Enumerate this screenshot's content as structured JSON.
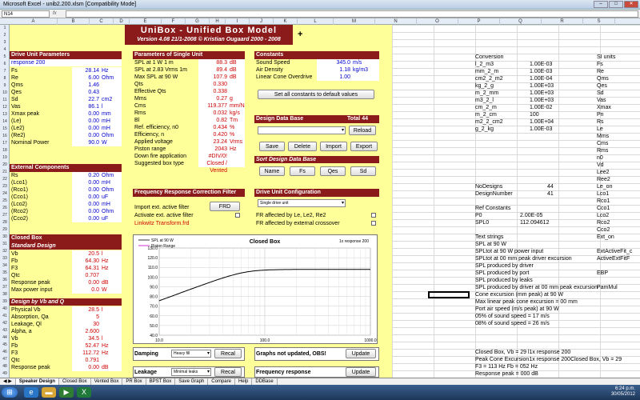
{
  "window": {
    "title": "Microsoft Excel - unib2.200.xlsm [Compatibility Mode]",
    "namebox": "N14",
    "fx": "fx"
  },
  "columns": [
    "A",
    "B",
    "C",
    "D",
    "E",
    "F",
    "G",
    "H",
    "I",
    "J",
    "K",
    "L",
    "M",
    "N",
    "O",
    "P",
    "Q",
    "R",
    "S"
  ],
  "rows": [
    "1",
    "2",
    "3",
    "4",
    "5",
    "6",
    "7",
    "8",
    "9",
    "10",
    "11",
    "12",
    "13",
    "14",
    "15",
    "16",
    "17",
    "18",
    "19",
    "20",
    "21",
    "22",
    "23",
    "24",
    "25",
    "26",
    "27",
    "28",
    "29",
    "30",
    "31",
    "32",
    "33",
    "34",
    "35",
    "36",
    "37",
    "38",
    "39",
    "40",
    "41",
    "42",
    "43",
    "44",
    "45",
    "46",
    "47",
    "48",
    "49",
    "50"
  ],
  "banner": {
    "title": "UniBox  -  Unified Box Model",
    "subtitle": "Version 4.08  21/1-2008   ©  Kristian Ougaard  2000 - 2008"
  },
  "drive": {
    "header": "Drive Unit Parameters",
    "name": "response 200",
    "rows": [
      {
        "l": "Fs",
        "v": "28.14",
        "u": "Hz"
      },
      {
        "l": "Re",
        "v": "6.00",
        "u": "Ohm"
      },
      {
        "l": "Qms",
        "v": "1.46",
        "u": ""
      },
      {
        "l": "Qes",
        "v": "0.43",
        "u": ""
      },
      {
        "l": "Sd",
        "v": "22.7",
        "u": "cm2"
      },
      {
        "l": "Vas",
        "v": "86.1",
        "u": "l"
      },
      {
        "l": "Xmax peak",
        "v": "0.00",
        "u": "mm"
      },
      {
        "l": "(Le)",
        "v": "0.00",
        "u": "mH"
      },
      {
        "l": "(Le2)",
        "v": "0.00",
        "u": "mH"
      },
      {
        "l": "(Re2)",
        "v": "0.00",
        "u": "Ohm"
      },
      {
        "l": "Nominal Power",
        "v": "90.0",
        "u": "W"
      }
    ]
  },
  "external": {
    "header": "External Components",
    "rows": [
      {
        "l": "Rs",
        "v": "0.20",
        "u": "Ohm"
      },
      {
        "l": "(Lco1)",
        "v": "0.00",
        "u": "mH"
      },
      {
        "l": "(Rco1)",
        "v": "0.00",
        "u": "Ohm"
      },
      {
        "l": "(Cco1)",
        "v": "0.00",
        "u": "uF"
      },
      {
        "l": "(Lco2)",
        "v": "0.00",
        "u": "mH"
      },
      {
        "l": "(Rco2)",
        "v": "0.00",
        "u": "Ohm"
      },
      {
        "l": "(Cco2)",
        "v": "0.00",
        "u": "uF"
      }
    ]
  },
  "closedbox": {
    "header": "Closed Box",
    "sub1": "Standard Design",
    "rows1": [
      {
        "l": "Vb",
        "v": "20.5",
        "u": "l"
      },
      {
        "l": "Fb",
        "v": "64.30",
        "u": "Hz"
      },
      {
        "l": "F3",
        "v": "64.31",
        "u": "Hz"
      },
      {
        "l": "Qtc",
        "v": "0.707",
        "u": ""
      },
      {
        "l": "Response peak",
        "v": "0.00",
        "u": "dB"
      },
      {
        "l": "Max power input",
        "v": "0.0",
        "u": "W"
      }
    ],
    "sub2": "Design by Vb and Q",
    "rows2": [
      {
        "l": "Physical Vb",
        "v": "28.5",
        "u": "l"
      },
      {
        "l": "Absorption, Qa",
        "v": "5",
        "u": ""
      },
      {
        "l": "Leakage, Ql",
        "v": "30",
        "u": ""
      },
      {
        "l": "Alpha, a",
        "v": "2.600",
        "u": ""
      },
      {
        "l": "Vb",
        "v": "34.5",
        "u": "l"
      },
      {
        "l": "Fb",
        "v": "52.47",
        "u": "Hz"
      },
      {
        "l": "F3",
        "v": "112.72",
        "u": "Hz"
      },
      {
        "l": "Qtc",
        "v": "0.791",
        "u": ""
      },
      {
        "l": "Response peak",
        "v": "0.00",
        "u": "dB"
      }
    ]
  },
  "single": {
    "header": "Parameters of Single Unit",
    "rows": [
      {
        "l": "SPL at 1 W 1 m",
        "v": "88.3",
        "u": "dB"
      },
      {
        "l": "SPL at 2.83 Vrms 1m",
        "v": "89.4",
        "u": "dB"
      },
      {
        "l": "Max SPL at 90 W",
        "v": "107.9",
        "u": "dB"
      },
      {
        "l": "Qts",
        "v": "0.330",
        "u": ""
      },
      {
        "l": "Effective Qts",
        "v": "0.338",
        "u": ""
      },
      {
        "l": "Mms",
        "v": "0.27",
        "u": "g"
      },
      {
        "l": "Cms",
        "v": "119.377",
        "u": "mm/N"
      },
      {
        "l": "Rms",
        "v": "0.032",
        "u": "kg/s"
      },
      {
        "l": "Bl",
        "v": "0.82",
        "u": "Tm"
      },
      {
        "l": "Ref. efficiency, n0",
        "v": "0.434",
        "u": "%"
      },
      {
        "l": "Efficiency, n",
        "v": "0.420",
        "u": "%"
      },
      {
        "l": "Applied voltage",
        "v": "23.24",
        "u": "Vrms"
      },
      {
        "l": "Piston range",
        "v": "2043",
        "u": "Hz"
      },
      {
        "l": "Down fire application",
        "v": "#DIV/0!",
        "u": ""
      },
      {
        "l": "Suggested box type",
        "v": "Closed / Vented",
        "u": ""
      }
    ]
  },
  "constants": {
    "header": "Constants",
    "rows": [
      {
        "l": "Sound Speed",
        "v": "345.0",
        "u": "m/s"
      },
      {
        "l": "Air Density",
        "v": "1.18",
        "u": "kg/m3"
      },
      {
        "l": "Linear Cone Overdrive",
        "v": "1.00",
        "u": ""
      }
    ],
    "reset_btn": "Set all constants to default values"
  },
  "database": {
    "header": "Design Data Base",
    "total_label": "Total",
    "total": "44",
    "reload": "Reload",
    "save": "Save",
    "delete": "Delete",
    "import": "Import",
    "export": "Export",
    "sort_header": "Sort Design Data Base",
    "sort_buttons": [
      "Name",
      "Fs",
      "Qes",
      "Sd"
    ]
  },
  "freqcorr": {
    "header": "Frequency Response Correction Filter",
    "import_label": "Import ext. active filter",
    "frd": "FRD",
    "activate_label": "Activate ext. active filter",
    "file": "Linkwitz Transform.frd"
  },
  "duconfig": {
    "header": "Drive Unit Configuration",
    "select": "Single drive unit",
    "fr1": "FR affected by Le, Le2, Re2",
    "fr2": "FR affected by external crossover"
  },
  "chart": {
    "title": "Closed Box",
    "legend": [
      "SPL at 90 W",
      "Piston Range"
    ],
    "corner_label": "1x response 200",
    "yticks": [
      "130.0",
      "120.0",
      "110.0",
      "100.0",
      "90.0",
      "80.0",
      "70.0",
      "60.0",
      "50.0",
      "40.0"
    ],
    "xticks": [
      "10.0",
      "100.0",
      "1000.0"
    ]
  },
  "chart_data": {
    "type": "line",
    "title": "Closed Box",
    "xlabel": "",
    "ylabel": "",
    "xscale": "log",
    "xlim": [
      10,
      1000
    ],
    "ylim": [
      40,
      130
    ],
    "series": [
      {
        "name": "SPL at 90 W",
        "x": [
          10,
          15,
          20,
          30,
          40,
          50,
          64.3,
          80,
          100,
          150,
          200,
          300,
          1000
        ],
        "y": [
          57.9,
          64.9,
          69.6,
          76.3,
          81.2,
          84.9,
          88.4,
          91.3,
          103.7,
          106.8,
          107.5,
          107.8,
          107.9
        ]
      }
    ]
  },
  "damping": {
    "label": "Damping",
    "select": "Heavy fill",
    "btn": "Recal"
  },
  "leakage": {
    "label": "Leakage",
    "select": "Minimal leaks",
    "btn": "Recal"
  },
  "graphs": {
    "label": "Graphs not updated, OBS!",
    "btn": "Update"
  },
  "freqresp": {
    "label": "Frequency response",
    "btn": "Update"
  },
  "right": {
    "header_p": "Conversion",
    "header_s": "SI units",
    "conv": [
      {
        "p": "l_2_m3",
        "q": "1.00E-03",
        "s": "Fs"
      },
      {
        "p": "mm_2_m",
        "q": "1.00E-03",
        "s": "Re"
      },
      {
        "p": "cm2_2_m2",
        "q": "1.00E-04",
        "s": "Qms"
      },
      {
        "p": "kg_2_g",
        "q": "1.00E+03",
        "s": "Qes"
      },
      {
        "p": "m_2_mm",
        "q": "1.00E+03",
        "s": "Sd"
      },
      {
        "p": "m3_2_l",
        "q": "1.00E+03",
        "s": "Vas"
      },
      {
        "p": "cm_2_m",
        "q": "1.00E-02",
        "s": "Xmax"
      },
      {
        "p": "m_2_cm",
        "q": "100",
        "s": "Pn"
      },
      {
        "p": "m2_2_cm2",
        "q": "1.00E+04",
        "s": "Rs"
      },
      {
        "p": "g_2_kg",
        "q": "1.00E-03",
        "s": "Le"
      }
    ],
    "s_extra": [
      "Mms",
      "Cms",
      "Rms",
      "n0",
      "Vd",
      "Lee2",
      "Ree2",
      "Le_on",
      "Lco1",
      "Rco1",
      "Cco1",
      "Lco2",
      "Rco2",
      "Cco2",
      "Ext_on",
      "",
      "ExtActiveFit_c",
      "ActiveExtFitF",
      "",
      "EBP",
      "",
      "PamMul"
    ],
    "nodesigns": {
      "l": "NoDesigns",
      "v": "44"
    },
    "designnumber": {
      "l": "DesignNumber",
      "v": "41"
    },
    "ref_constants": "Ref Constants",
    "p0": {
      "l": "P0",
      "v": "2.00E-05"
    },
    "spl0": {
      "l": "SPL0",
      "v": "112.094612"
    },
    "text_strings": "Text strings",
    "lines": [
      "SPL at 90 W",
      "SPLtot at 90 W power input",
      "SPLtot at 00 mm peak driver excursion",
      "SPL produced by driver",
      "SPL produced by port",
      "SPL produced by leaks",
      "SPL produced by driver at 00 mm peak excursion",
      "Cone excursion (mm peak) at 90 W",
      "Max linear peak cone excursion = 00 mm",
      "Port air speed (m/s peak) at 90 W",
      "05% of sound speed = 17 m/s",
      "08% of sound speed = 26 m/s"
    ],
    "lines2": [
      "Closed Box, Vb = 29 l1x response 200",
      "Peak Cone Excursion1x response 200Closed Box, Vb = 29",
      "F3 = 113 Hz  Fb = 052 Hz",
      "Response peak = 000 dB"
    ],
    "so": "Co",
    "extra_o": "Co"
  },
  "sheet_tabs": [
    "Speaker Design",
    "Closed Box",
    "Vented Box",
    "PR Box",
    "BPST Box",
    "Save Graph",
    "Compare",
    "Help",
    "DDBase"
  ],
  "taskbar": {
    "time": "6:24 p.m.",
    "date": "30/05/2012"
  }
}
